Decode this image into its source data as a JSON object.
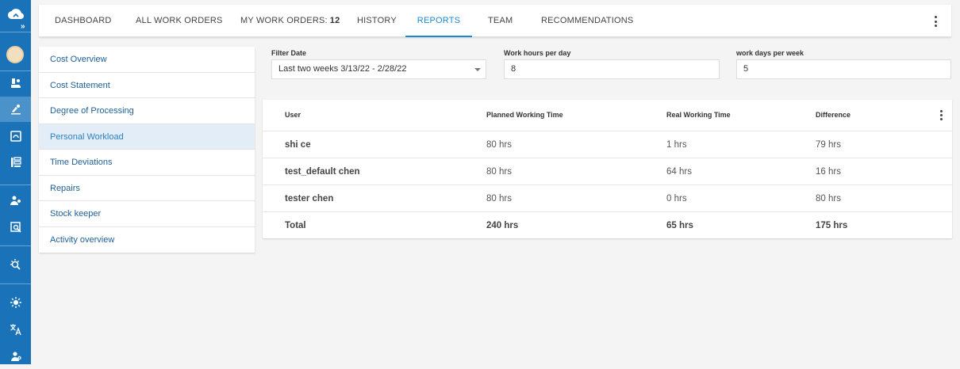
{
  "nav": {
    "tabs": [
      {
        "label": "DASHBOARD"
      },
      {
        "label": "ALL WORK ORDERS"
      },
      {
        "label": "MY WORK ORDERS:",
        "count": "12"
      },
      {
        "label": "HISTORY"
      },
      {
        "label": "REPORTS"
      },
      {
        "label": "TEAM"
      },
      {
        "label": "RECOMMENDATIONS"
      }
    ],
    "active_tab": "REPORTS"
  },
  "reports_menu": {
    "items": [
      {
        "label": "Cost Overview"
      },
      {
        "label": "Cost Statement"
      },
      {
        "label": "Degree of Processing"
      },
      {
        "label": "Personal Workload"
      },
      {
        "label": "Time Deviations"
      },
      {
        "label": "Repairs"
      },
      {
        "label": "Stock keeper"
      },
      {
        "label": "Activity overview"
      }
    ],
    "active_item": "Personal Workload"
  },
  "filters": {
    "filter_date": {
      "label": "Filter Date",
      "value": "Last two weeks 3/13/22 - 2/28/22"
    },
    "work_hours": {
      "label": "Work hours per day",
      "value": "8"
    },
    "work_days": {
      "label": "work days per week",
      "value": "5"
    }
  },
  "table": {
    "headers": [
      "User",
      "Planned Working Time",
      "Real Working Time",
      "Difference"
    ],
    "rows": [
      {
        "user": "shi ce",
        "planned": "80 hrs",
        "real": "1 hrs",
        "difference": "79 hrs"
      },
      {
        "user": "test_default chen",
        "planned": "80 hrs",
        "real": "64 hrs",
        "difference": "16 hrs"
      },
      {
        "user": "tester chen",
        "planned": "80 hrs",
        "real": "0 hrs",
        "difference": "80 hrs"
      }
    ],
    "total": {
      "user": "Total",
      "planned": "240 hrs",
      "real": "65 hrs",
      "difference": "175 hrs"
    }
  },
  "sidebar_icons": [
    "cloud-logo-icon",
    "expand-icon",
    "user-avatar",
    "work-order-icon",
    "maintenance-icon",
    "reports-icon",
    "list-icon",
    "team-icon",
    "inspection-icon",
    "recommendations-icon",
    "settings-icon",
    "language-icon",
    "account-icon"
  ],
  "colors": {
    "rail": "#1a73b8",
    "accent": "#1b88cf",
    "menu_active_bg": "#e3edf7",
    "link": "#1f5f95"
  }
}
